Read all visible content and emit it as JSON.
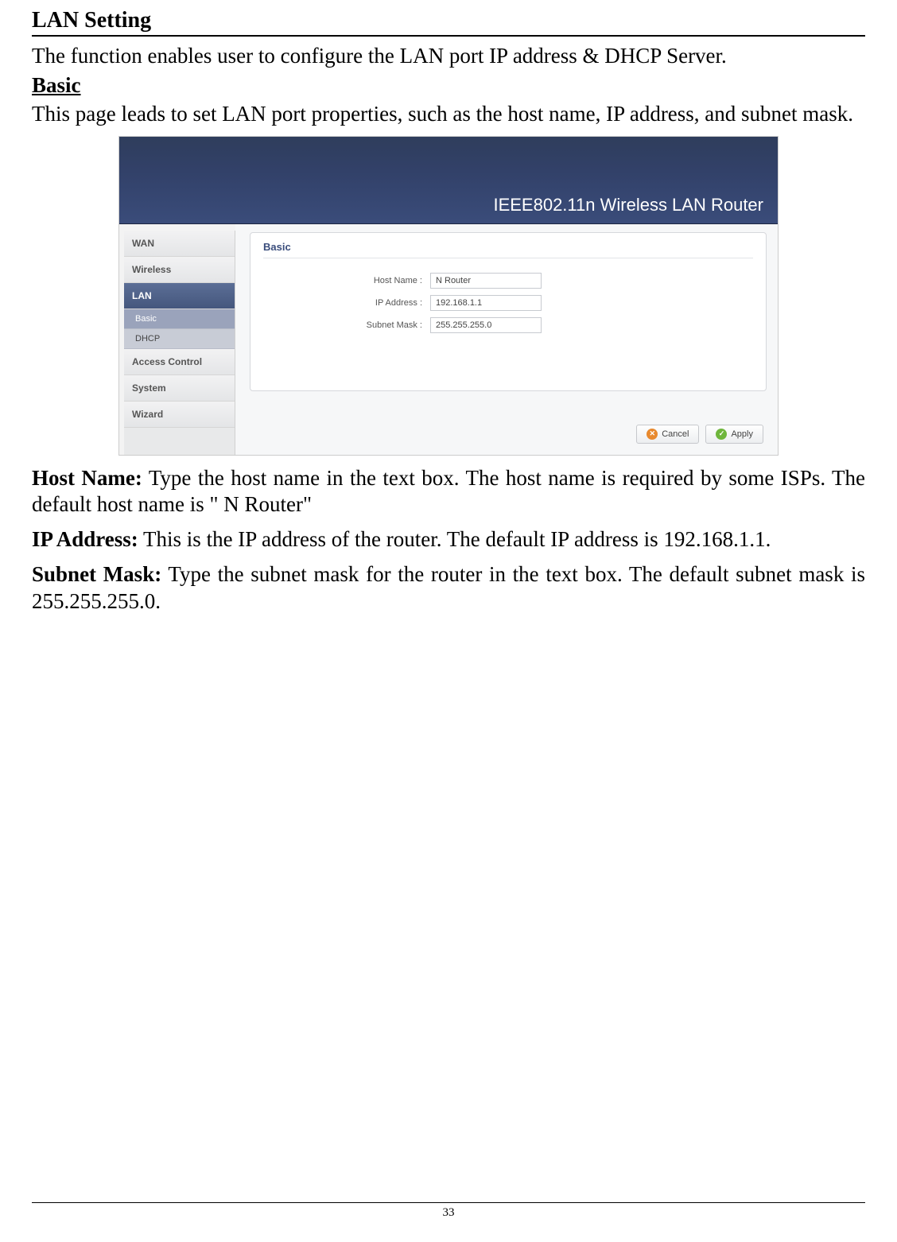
{
  "doc": {
    "section_title": "LAN Setting",
    "intro": "The function enables user to configure the LAN port IP address & DHCP Server.",
    "sub_title": "Basic",
    "basic_para": "This page leads to set LAN port properties, such as the host name, IP address, and subnet mask.",
    "host_name_label": "Host Name:",
    "host_name_text": " Type the host name in the text box. The host name is required by some ISPs. The default host name is \" N Router\"",
    "ip_label": "IP Address:",
    "ip_text": " This is the IP address of the router. The default IP address is 192.168.1.1.",
    "subnet_label": "Subnet Mask:",
    "subnet_text": " Type the subnet mask for the router in the text box. The default subnet mask is 255.255.255.0.",
    "page_number": "33"
  },
  "router": {
    "banner_title": "IEEE802.11n  Wireless LAN Router",
    "sidebar": {
      "wan": "WAN",
      "wireless": "Wireless",
      "lan": "LAN",
      "basic": "Basic",
      "dhcp": "DHCP",
      "access_control": "Access Control",
      "system": "System",
      "wizard": "Wizard"
    },
    "panel": {
      "title": "Basic",
      "host_name_label": "Host Name :",
      "host_name_value": "N Router",
      "ip_label": "IP Address :",
      "ip_value": "192.168.1.1",
      "subnet_label": "Subnet Mask :",
      "subnet_value": "255.255.255.0"
    },
    "buttons": {
      "cancel": "Cancel",
      "apply": "Apply"
    }
  }
}
